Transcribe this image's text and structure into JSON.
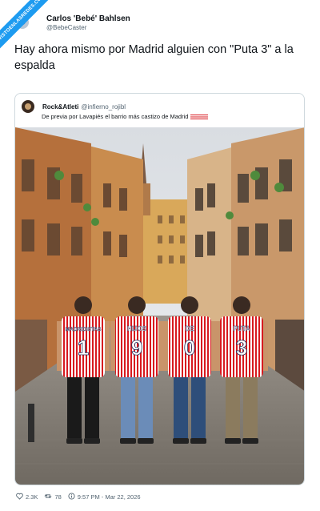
{
  "ribbon": {
    "text": "VISTOENLASREDES.COM"
  },
  "author": {
    "display_name": "Carlos 'Bebé' Bahlsen",
    "handle": "@BebeCaster"
  },
  "tweet": {
    "text": "Hay ahora mismo por Madrid alguien con \"Puta 3\" a la espalda"
  },
  "quoted": {
    "display_name": "Rock&Atleti",
    "handle": "@infierno_rojibl",
    "text": "De previa por Lavapiés el barrio más castizo de Madrid",
    "flag_colors": [
      "#d7191f",
      "#ffffff"
    ]
  },
  "photo": {
    "shirts": [
      {
        "name": "MADRIDISTAS",
        "number": "1"
      },
      {
        "name": "HIJOS",
        "number": "9"
      },
      {
        "name": "DE",
        "number": "0"
      },
      {
        "name": "PUTA",
        "number": "3"
      }
    ]
  },
  "footer": {
    "likes": "2.3K",
    "retweets": "78",
    "timestamp": "9:57 PM - Mar 22, 2026"
  },
  "colors": {
    "accent": "#1d9bf0",
    "text": "#0f1419",
    "muted": "#536471",
    "stripe_red": "#d7191f"
  }
}
